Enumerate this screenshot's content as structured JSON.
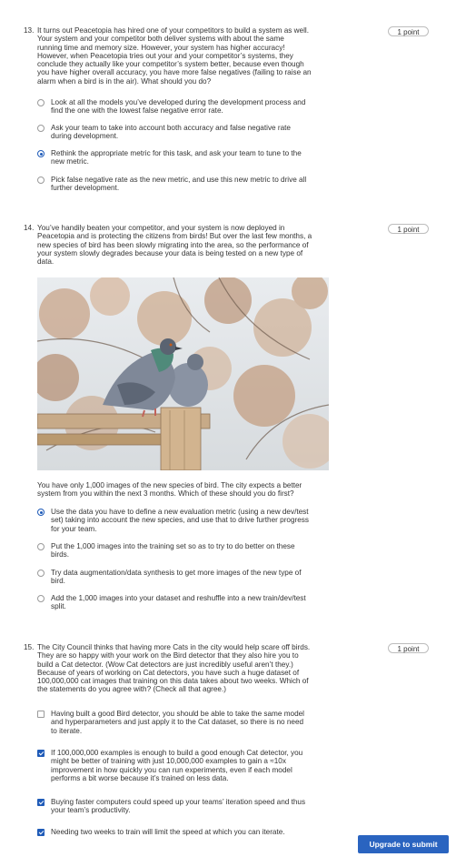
{
  "q13": {
    "number": "13.",
    "points": "1 point",
    "lines": [
      "It turns out Peacetopia has hired one of your competitors to build a system as well.",
      "Your system and your competitor both deliver systems with about the same",
      "running time and memory size. However, your system has higher accuracy!",
      "However, when Peacetopia tries out your and your competitor’s systems, they",
      "conclude they actually like your competitor’s system better, because even though",
      "you have higher overall accuracy, you have more false negatives (failing to raise an",
      "alarm when a bird is in the air). What should you do?"
    ],
    "options": [
      {
        "selected": false,
        "lines": [
          "Look at all the models you’ve developed during the development process and",
          "find the one with the lowest false negative error rate."
        ]
      },
      {
        "selected": false,
        "lines": [
          "Ask your team to take into account both accuracy and false negative rate",
          "during development."
        ]
      },
      {
        "selected": true,
        "lines": [
          "Rethink the appropriate metric for this task, and ask your team to tune to the",
          "new metric."
        ]
      },
      {
        "selected": false,
        "lines": [
          "Pick false negative rate as the new metric, and use this new metric to drive all",
          "further development."
        ]
      }
    ]
  },
  "q14": {
    "number": "14.",
    "points": "1 point",
    "lines": [
      "You’ve handily beaten your competitor, and your system is now deployed in",
      "Peacetopia and is protecting the citizens from birds! But over the last few months, a",
      "new species of bird has been slowly migrating into the area, so the performance of",
      "your system slowly degrades because your data is being tested on a new type of",
      "data."
    ],
    "followup": [
      "You have only 1,000 images of the new species of bird. The city expects a better",
      "system from you within the next 3 months. Which of these should you do first?"
    ],
    "options": [
      {
        "selected": true,
        "lines": [
          "Use the data you have to define a new evaluation metric (using a new dev/test",
          "set) taking into account the new species, and use that to drive further progress",
          "for your team."
        ]
      },
      {
        "selected": false,
        "lines": [
          "Put the 1,000 images into the training set so as to try to do better on these",
          "birds."
        ]
      },
      {
        "selected": false,
        "lines": [
          "Try data augmentation/data synthesis to get more images of the new type of",
          "bird."
        ]
      },
      {
        "selected": false,
        "lines": [
          "Add the 1,000 images into your dataset and reshuffle into a new train/dev/test",
          "split."
        ]
      }
    ]
  },
  "q15": {
    "number": "15.",
    "points": "1 point",
    "lines": [
      "The City Council thinks that having more Cats in the city would help scare off birds.",
      "They are so happy with your work on the Bird detector that they also hire you to",
      "build a Cat detector. (Wow Cat detectors are just incredibly useful aren’t they.)",
      "Because of years of working on Cat detectors, you have such a huge dataset of",
      "100,000,000 cat images that training on this data takes about two weeks. Which of",
      "the statements do you agree with? (Check all that agree.)"
    ],
    "options": [
      {
        "selected": false,
        "lines": [
          "Having built a good Bird detector, you should be able to take the same model",
          "and hyperparameters and just apply it to the Cat dataset, so there is no need",
          "to iterate."
        ]
      },
      {
        "selected": true,
        "lines": [
          "If 100,000,000 examples is enough to build a good enough Cat detector, you",
          "might be better of training with just 10,000,000 examples to gain a ≈10x",
          "improvement in how quickly you can run experiments, even if each model",
          "performs a bit worse because it’s trained on less data."
        ]
      },
      {
        "selected": true,
        "lines": [
          "Buying faster computers could speed up your teams’ iteration speed and thus",
          "your team’s productivity."
        ]
      },
      {
        "selected": true,
        "lines": [
          "Needing two weeks to train will limit the speed at which you can iterate."
        ]
      }
    ]
  },
  "submit_label": "Upgrade to submit",
  "colors": {
    "accent": "#2a64c0",
    "text": "#333333",
    "selected": "#1f5bb8"
  }
}
